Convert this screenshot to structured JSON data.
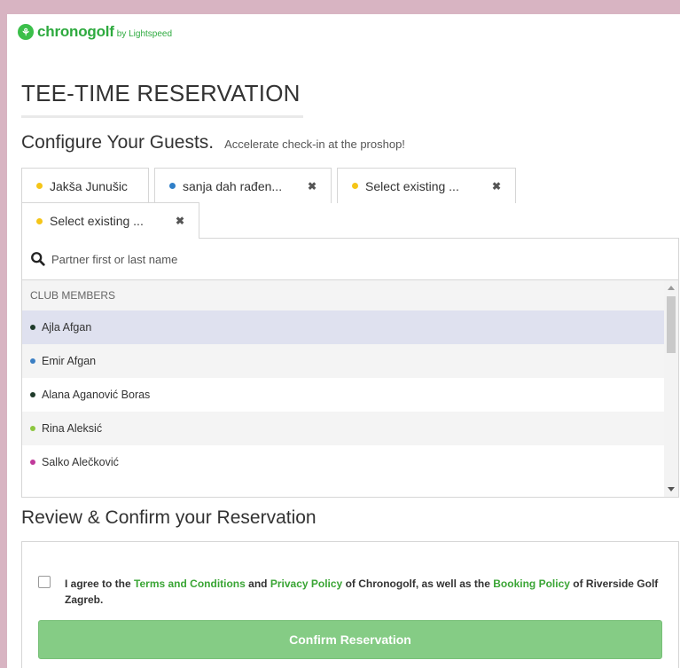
{
  "brand": {
    "name": "chronogolf",
    "by": "by Lightspeed",
    "color": "#2eaa3f"
  },
  "title": "TEE-TIME RESERVATION",
  "guests_section": {
    "heading": "Configure Your Guests.",
    "subheading": "Accelerate check-in at the proshop!"
  },
  "tabs": [
    {
      "label": "Jakša Junušic",
      "dot_color": "#f5c518",
      "closable": false
    },
    {
      "label": "sanja dah rađen...",
      "dot_color": "#2f7fc8",
      "closable": true
    },
    {
      "label": "Select existing ...",
      "dot_color": "#f5c518",
      "closable": true
    },
    {
      "label": "Select existing ...",
      "dot_color": "#f5c518",
      "closable": true,
      "active": true
    }
  ],
  "close_glyph": "✖",
  "search": {
    "placeholder": "Partner first or last name",
    "value": ""
  },
  "members": {
    "header": "CLUB MEMBERS",
    "items": [
      {
        "name": "Ajla Afgan",
        "dot_color": "#1f3b2a",
        "selected": true
      },
      {
        "name": "Emir Afgan",
        "dot_color": "#3b7fc4"
      },
      {
        "name": "Alana Aganović Boras",
        "dot_color": "#1f3b2a"
      },
      {
        "name": "Rina Aleksić",
        "dot_color": "#8cc63f"
      },
      {
        "name": "Salko Alečković",
        "dot_color": "#c0399a"
      }
    ]
  },
  "review": {
    "heading": "Review & Confirm your Reservation",
    "agree": {
      "p1": "I agree to the ",
      "terms": "Terms and Conditions",
      "p2": " and ",
      "privacy": "Privacy Policy",
      "p3": " of Chronogolf, as well as the ",
      "booking": "Booking Policy",
      "p4": " of Riverside Golf Zagreb.",
      "checked": false
    },
    "confirm_label": "Confirm Reservation"
  }
}
